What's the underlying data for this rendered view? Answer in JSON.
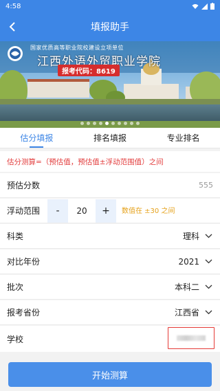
{
  "status": {
    "time": "4:58"
  },
  "header": {
    "title": "填报助手"
  },
  "banner": {
    "caption_top": "国家优质高等职业院校建设立项单位",
    "school_name": "江西外语外贸职业学院",
    "code_label": "报考代码：8619"
  },
  "tabs": [
    {
      "label": "估分填报"
    },
    {
      "label": "排名填报"
    },
    {
      "label": "专业排名"
    }
  ],
  "formula": "估分测算=（预估值，预估值±浮动范围值）之间",
  "form": {
    "estimate": {
      "label": "预估分数",
      "value": "555"
    },
    "float_range": {
      "label": "浮动范围",
      "minus": "-",
      "value": "20",
      "plus": "+",
      "hint": "数值在 ±30 之间"
    },
    "subject": {
      "label": "科类",
      "value": "理科"
    },
    "year": {
      "label": "对比年份",
      "value": "2021"
    },
    "batch": {
      "label": "批次",
      "value": "本科二"
    },
    "province": {
      "label": "报考省份",
      "value": "江西省"
    },
    "school": {
      "label": "学校"
    }
  },
  "submit_label": "开始测算",
  "colors": {
    "primary": "#3d86e6",
    "warning": "#e5a11a",
    "danger": "#e23a3a"
  }
}
